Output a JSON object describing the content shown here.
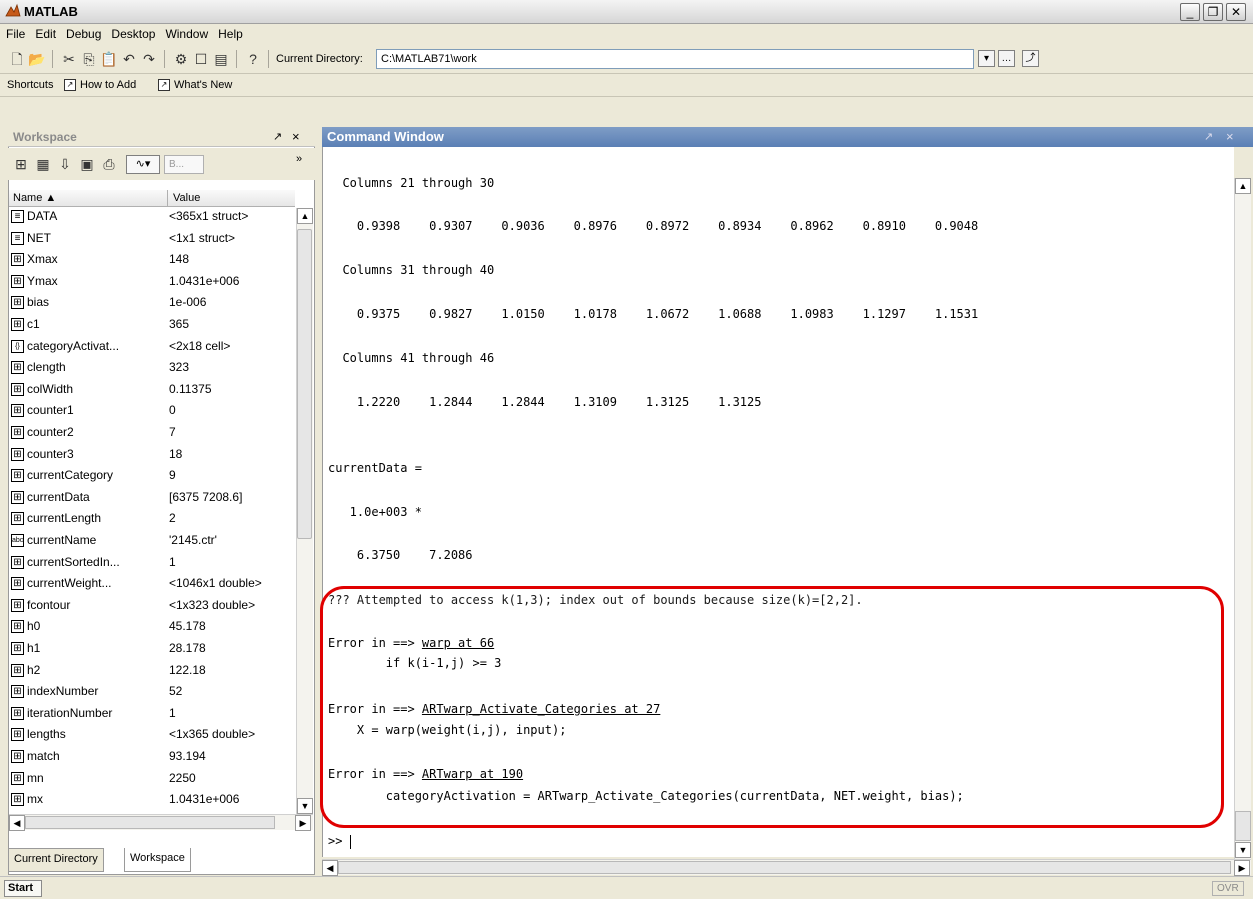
{
  "window": {
    "title": "MATLAB"
  },
  "menu": [
    "File",
    "Edit",
    "Debug",
    "Desktop",
    "Window",
    "Help"
  ],
  "toolbar": {
    "current_directory_label": "Current Directory:",
    "current_directory_value": "C:\\MATLAB71\\work"
  },
  "shortcuts": {
    "label": "Shortcuts",
    "how_to_add": "How to Add",
    "whats_new": "What's New"
  },
  "workspace": {
    "title": "Workspace",
    "plot_selector": "B...",
    "col_name": "Name ▲",
    "col_value": "Value",
    "rows": [
      {
        "name": "DATA",
        "value": "<365x1 struct>",
        "icon": "struct-icon"
      },
      {
        "name": "NET",
        "value": "<1x1 struct>",
        "icon": "struct-icon"
      },
      {
        "name": "Xmax",
        "value": "148",
        "icon": "matrix-icon"
      },
      {
        "name": "Ymax",
        "value": "1.0431e+006",
        "icon": "matrix-icon"
      },
      {
        "name": "bias",
        "value": "1e-006",
        "icon": "matrix-icon"
      },
      {
        "name": "c1",
        "value": "365",
        "icon": "matrix-icon"
      },
      {
        "name": "categoryActivat...",
        "value": "<2x18 cell>",
        "icon": "cell-icon"
      },
      {
        "name": "clength",
        "value": "323",
        "icon": "matrix-icon"
      },
      {
        "name": "colWidth",
        "value": "0.11375",
        "icon": "matrix-icon"
      },
      {
        "name": "counter1",
        "value": "0",
        "icon": "matrix-icon"
      },
      {
        "name": "counter2",
        "value": "7",
        "icon": "matrix-icon"
      },
      {
        "name": "counter3",
        "value": "18",
        "icon": "matrix-icon"
      },
      {
        "name": "currentCategory",
        "value": "9",
        "icon": "matrix-icon"
      },
      {
        "name": "currentData",
        "value": "[6375 7208.6]",
        "icon": "matrix-icon"
      },
      {
        "name": "currentLength",
        "value": "2",
        "icon": "matrix-icon"
      },
      {
        "name": "currentName",
        "value": "'2145.ctr'",
        "icon": "char-icon"
      },
      {
        "name": "currentSortedIn...",
        "value": "1",
        "icon": "matrix-icon"
      },
      {
        "name": "currentWeight...",
        "value": "<1046x1 double>",
        "icon": "matrix-icon"
      },
      {
        "name": "fcontour",
        "value": "<1x323 double>",
        "icon": "matrix-icon"
      },
      {
        "name": "h0",
        "value": "45.178",
        "icon": "matrix-icon"
      },
      {
        "name": "h1",
        "value": "28.178",
        "icon": "matrix-icon"
      },
      {
        "name": "h2",
        "value": "122.18",
        "icon": "matrix-icon"
      },
      {
        "name": "indexNumber",
        "value": "52",
        "icon": "matrix-icon"
      },
      {
        "name": "iterationNumber",
        "value": "1",
        "icon": "matrix-icon"
      },
      {
        "name": "lengths",
        "value": "<1x365 double>",
        "icon": "matrix-icon"
      },
      {
        "name": "match",
        "value": "93.194",
        "icon": "matrix-icon"
      },
      {
        "name": "mn",
        "value": "2250",
        "icon": "matrix-icon"
      },
      {
        "name": "mx",
        "value": "1.0431e+006",
        "icon": "matrix-icon"
      }
    ]
  },
  "tabs": {
    "current_directory": "Current Directory",
    "workspace": "Workspace"
  },
  "command_window": {
    "title": "Command Window",
    "lines": [
      "  Columns 21 through 30",
      "    0.9398    0.9307    0.9036    0.8976    0.8972    0.8934    0.8962    0.8910    0.9048",
      "  Columns 31 through 40",
      "    0.9375    0.9827    1.0150    1.0178    1.0672    1.0688    1.0983    1.1297    1.1531",
      "  Columns 41 through 46",
      "    1.2220    1.2844    1.2844    1.3109    1.3125    1.3125",
      "currentData =",
      "   1.0e+003 *",
      "    6.3750    7.2086",
      "??? Attempted to access k(1,3); index out of bounds because size(k)=[2,2]."
    ],
    "errors": [
      {
        "prefix": "Error in ==> ",
        "link": "warp at 66",
        "code": "        if k(i-1,j) >= 3"
      },
      {
        "prefix": "Error in ==> ",
        "link": "ARTwarp_Activate_Categories at 27",
        "code": "    X = warp(weight(i,j), input);"
      },
      {
        "prefix": "Error in ==> ",
        "link": "ARTwarp at 190",
        "code": "        categoryActivation = ARTwarp_Activate_Categories(currentData, NET.weight, bias);"
      }
    ],
    "prompt": ">>"
  },
  "status": {
    "start": "Start",
    "ovr": "OVR"
  },
  "colors": {
    "title_accent": "#5a7fb5",
    "highlight": "#e00000"
  }
}
